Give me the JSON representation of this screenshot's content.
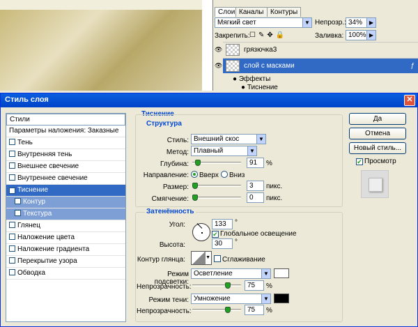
{
  "layers_panel": {
    "tabs": [
      "Слои",
      "Каналы",
      "Контуры"
    ],
    "blend_mode": "Мягкий свет",
    "opacity_label": "Непрозр.:",
    "opacity_value": "34%",
    "lock_label": "Закрепить:",
    "fill_label": "Заливка:",
    "fill_value": "100%",
    "layers": [
      {
        "name": "грязючка3"
      },
      {
        "name": "слой с масками"
      }
    ],
    "effects_label": "Эффекты",
    "effect_item": "Тиснение"
  },
  "dialog": {
    "title": "Стиль слоя",
    "styles_header": "Стили",
    "blending_options": "Параметры наложения: Заказные",
    "style_items": [
      {
        "label": "Тень",
        "checked": false
      },
      {
        "label": "Внутренняя тень",
        "checked": false
      },
      {
        "label": "Внешнее свечение",
        "checked": false
      },
      {
        "label": "Внутреннее свечение",
        "checked": false
      },
      {
        "label": "Тиснение",
        "checked": true
      },
      {
        "label": "Контур",
        "checked": false
      },
      {
        "label": "Текстура",
        "checked": false
      },
      {
        "label": "Глянец",
        "checked": false
      },
      {
        "label": "Наложение цвета",
        "checked": false
      },
      {
        "label": "Наложение градиента",
        "checked": false
      },
      {
        "label": "Перекрытие узора",
        "checked": false
      },
      {
        "label": "Обводка",
        "checked": false
      }
    ],
    "emboss": {
      "section": "Тиснение",
      "structure": "Структура",
      "style_label": "Стиль:",
      "style_value": "Внешний скос",
      "method_label": "Метод:",
      "method_value": "Плавный",
      "depth_label": "Глубина:",
      "depth_value": "91",
      "depth_unit": "%",
      "direction_label": "Направление:",
      "dir_up": "Вверх",
      "dir_down": "Вниз",
      "size_label": "Размер:",
      "size_value": "3",
      "size_unit": "пикс.",
      "soften_label": "Смягчение:",
      "soften_value": "0",
      "soften_unit": "пикс."
    },
    "shading": {
      "section": "Затенённость",
      "angle_label": "Угол:",
      "angle_value": "133",
      "angle_unit": "°",
      "global_light": "Глобальное освещение",
      "altitude_label": "Высота:",
      "altitude_value": "30",
      "altitude_unit": "°",
      "gloss_label": "Контур глянца:",
      "antialias": "Сглаживание",
      "highlight_label": "Режим подсветки:",
      "highlight_value": "Осветление",
      "highlight_color": "#ffffff",
      "opacity1_label": "Непрозрачность:",
      "opacity1_value": "75",
      "opacity1_unit": "%",
      "shadow_label": "Режим тени:",
      "shadow_value": "Умножение",
      "shadow_color": "#000000",
      "opacity2_label": "Непрозрачность:",
      "opacity2_value": "75",
      "opacity2_unit": "%"
    },
    "buttons": {
      "ok": "Да",
      "cancel": "Отмена",
      "new_style": "Новый стиль...",
      "preview": "Просмотр"
    }
  }
}
